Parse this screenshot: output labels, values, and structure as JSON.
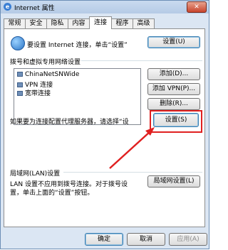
{
  "window": {
    "title": "Internet 属性",
    "close_glyph": "✕"
  },
  "tabs": [
    {
      "label": "常规"
    },
    {
      "label": "安全"
    },
    {
      "label": "隐私"
    },
    {
      "label": "内容"
    },
    {
      "label": "连接",
      "active": true
    },
    {
      "label": "程序"
    },
    {
      "label": "高级"
    }
  ],
  "setup": {
    "text": "要设置 Internet 连接，单击“设置”",
    "button": "设置(U)"
  },
  "dialup": {
    "heading": "拨号和虚拟专用网络设置",
    "items": [
      {
        "label": "ChinaNetSNWide"
      },
      {
        "label": "VPN 连接"
      },
      {
        "label": "宽带连接"
      }
    ],
    "add_button": "添加(D)...",
    "add_vpn_button": "添加 VPN(P)...",
    "remove_button": "删除(R)...",
    "proxy_text": "如果要为连接配置代理服务器，请选择“设",
    "settings_button": "设置(S)"
  },
  "lan": {
    "heading": "局域网(LAN)设置",
    "text_line1": "LAN 设置不应用到拨号连接。对于拨号设",
    "text_line2": "置，单击上面的“设置”按钮。",
    "button": "局域网设置(L)"
  },
  "footer": {
    "ok": "确定",
    "cancel": "取消",
    "apply": "应用(A)"
  },
  "colors": {
    "highlight": "#e02020",
    "accent": "#3b7fd4"
  }
}
